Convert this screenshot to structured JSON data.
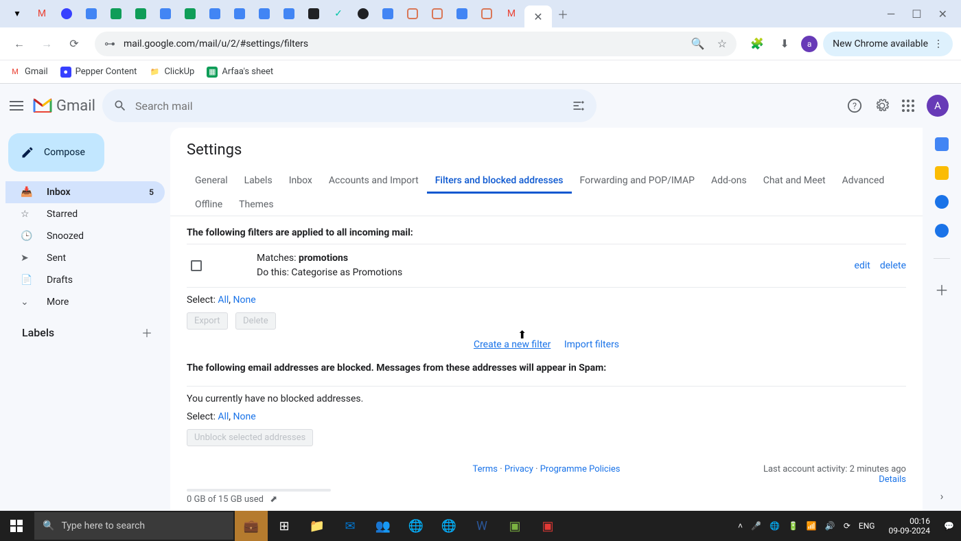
{
  "browser": {
    "url": "mail.google.com/mail/u/2/#settings/filters",
    "update_label": "New Chrome available",
    "profile_letter": "a"
  },
  "bookmarks": [
    {
      "label": "Gmail",
      "color": "#ea4335"
    },
    {
      "label": "Pepper Content",
      "color": "#3740ff"
    },
    {
      "label": "ClickUp",
      "color": "#5f6368"
    },
    {
      "label": "Arfaa's sheet",
      "color": "#0f9d58"
    }
  ],
  "gmail": {
    "brand": "Gmail",
    "search_placeholder": "Search mail",
    "avatar_letter": "A",
    "compose_label": "Compose",
    "nav": [
      {
        "label": "Inbox",
        "icon": "inbox",
        "active": true,
        "count": "5"
      },
      {
        "label": "Starred",
        "icon": "star"
      },
      {
        "label": "Snoozed",
        "icon": "clock"
      },
      {
        "label": "Sent",
        "icon": "send"
      },
      {
        "label": "Drafts",
        "icon": "draft"
      },
      {
        "label": "More",
        "icon": "more"
      }
    ],
    "labels_header": "Labels"
  },
  "settings": {
    "title": "Settings",
    "tabs": [
      "General",
      "Labels",
      "Inbox",
      "Accounts and Import",
      "Filters and blocked addresses",
      "Forwarding and POP/IMAP",
      "Add-ons",
      "Chat and Meet",
      "Advanced",
      "Offline",
      "Themes"
    ],
    "active_tab": "Filters and blocked addresses",
    "filters_heading": "The following filters are applied to all incoming mail:",
    "filter": {
      "matches_label": "Matches: ",
      "matches_value": "promotions",
      "dothis": "Do this: Categorise as Promotions",
      "edit": "edit",
      "delete": "delete"
    },
    "select_label": "Select: ",
    "select_all": "All",
    "select_none": "None",
    "export_btn": "Export",
    "delete_btn": "Delete",
    "create_filter": "Create a new filter",
    "import_filters": "Import filters",
    "blocked_heading": "The following email addresses are blocked. Messages from these addresses will appear in Spam:",
    "blocked_empty": "You currently have no blocked addresses.",
    "unblock_btn": "Unblock selected addresses"
  },
  "footer": {
    "terms": "Terms",
    "privacy": "Privacy",
    "policies": "Programme Policies",
    "activity": "Last account activity: 2 minutes ago",
    "details": "Details",
    "storage": "0 GB of 15 GB used"
  },
  "taskbar": {
    "search_placeholder": "Type here to search",
    "lang": "ENG",
    "time": "00:16",
    "date": "09-09-2024"
  }
}
